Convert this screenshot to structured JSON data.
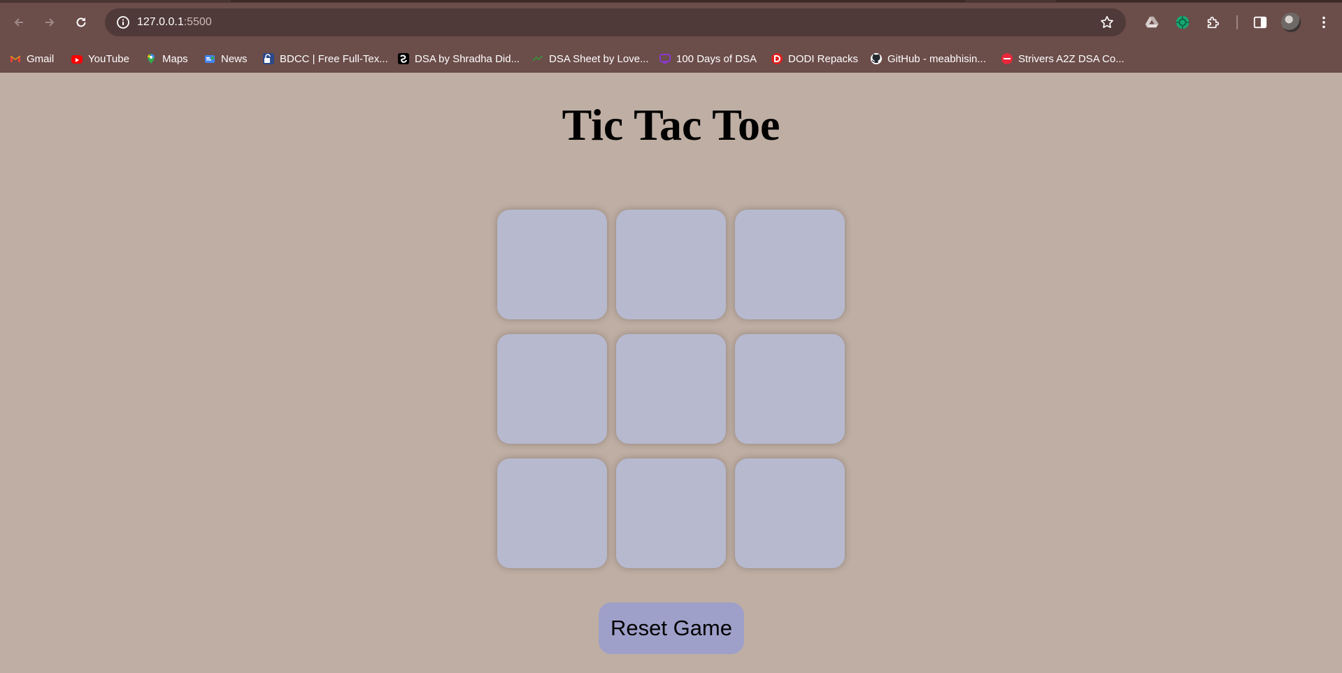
{
  "browser": {
    "url_host": "127.0.0.1",
    "url_port": ":5500",
    "bookmarks": [
      {
        "label": "Gmail",
        "icon": "gmail-icon"
      },
      {
        "label": "YouTube",
        "icon": "youtube-icon"
      },
      {
        "label": "Maps",
        "icon": "maps-icon"
      },
      {
        "label": "News",
        "icon": "news-icon"
      },
      {
        "label": "BDCC | Free Full-Tex...",
        "icon": "bdcc-icon"
      },
      {
        "label": "DSA by Shradha Did...",
        "icon": "dsa-shradha-icon"
      },
      {
        "label": "DSA Sheet by Love...",
        "icon": "dsa-sheet-icon"
      },
      {
        "label": "100 Days of DSA",
        "icon": "100-days-icon"
      },
      {
        "label": "DODI Repacks",
        "icon": "dodi-icon"
      },
      {
        "label": "GitHub - meabhisin...",
        "icon": "github-icon"
      },
      {
        "label": "Strivers A2Z DSA Co...",
        "icon": "tuf-icon"
      }
    ]
  },
  "game": {
    "title": "Tic Tac Toe",
    "cells": [
      "",
      "",
      "",
      "",
      "",
      "",
      "",
      "",
      ""
    ],
    "reset_label": "Reset Game"
  },
  "colors": {
    "page_background": "#bfaea3",
    "cell": "#b7b9cf",
    "reset_button": "#9fa0c9",
    "browser_frame": "#6b4d4a"
  }
}
